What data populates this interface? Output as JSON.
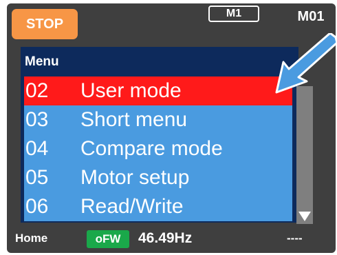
{
  "header": {
    "stop_label": "STOP",
    "mode_badge": "M1",
    "mode_code": "M01"
  },
  "menu": {
    "title": "Menu",
    "items": [
      {
        "num": "02",
        "label": "User mode",
        "selected": true
      },
      {
        "num": "03",
        "label": "Short menu",
        "selected": false
      },
      {
        "num": "04",
        "label": "Compare mode",
        "selected": false
      },
      {
        "num": "05",
        "label": "Motor setup",
        "selected": false
      },
      {
        "num": "06",
        "label": "Read/Write",
        "selected": false
      }
    ]
  },
  "status": {
    "home_label": "Home",
    "ofw_label": "oFW",
    "frequency": "46.49Hz",
    "right_text": "----"
  },
  "colors": {
    "stop": "#f79646",
    "menu_bg": "#4a9be0",
    "selected": "#ff1a1a",
    "ofw": "#1aa84a",
    "pointer_arrow": "#4a9be0"
  },
  "icons": {
    "scroll_down": "triangle-down-icon",
    "pointer": "arrow-pointer-icon"
  }
}
